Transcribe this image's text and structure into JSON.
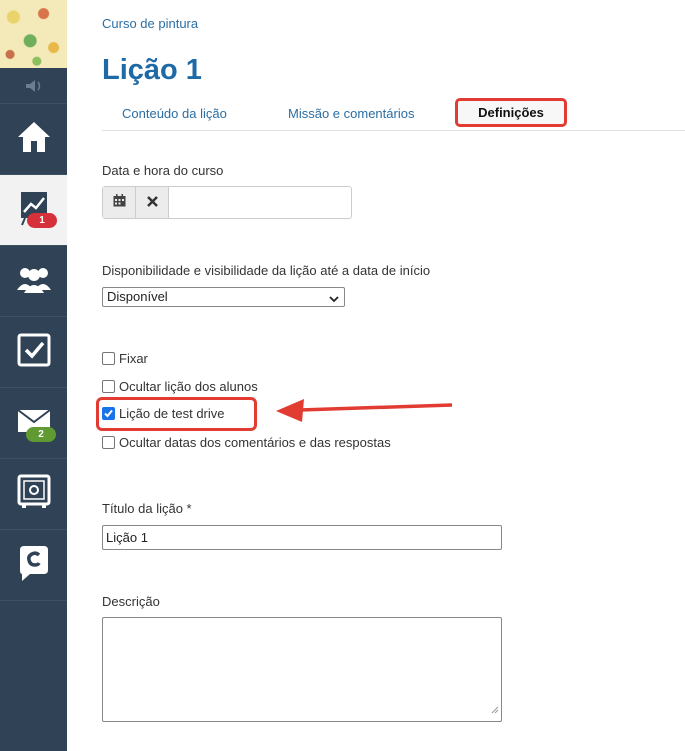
{
  "breadcrumb": "Curso de pintura",
  "page_title": "Lição 1",
  "tabs": [
    {
      "label": "Conteúdo da lição"
    },
    {
      "label": "Missão e comentários"
    },
    {
      "label": "Definições"
    }
  ],
  "sidebar": {
    "items": [
      {
        "icon": "home-icon"
      },
      {
        "icon": "chart-icon",
        "badge": "1"
      },
      {
        "icon": "group-icon"
      },
      {
        "icon": "checkbox-icon"
      },
      {
        "icon": "mail-icon",
        "badge": "2"
      },
      {
        "icon": "safe-icon"
      },
      {
        "icon": "chat-c-icon"
      }
    ]
  },
  "form": {
    "date_label": "Data e hora do curso",
    "date_value": "",
    "availability_label": "Disponibilidade e visibilidade da lição até a data de início",
    "availability_value": "Disponível",
    "options": [
      {
        "label": "Fixar",
        "checked": false
      },
      {
        "label": "Ocultar lição dos alunos",
        "checked": false
      },
      {
        "label": "Lição de test drive",
        "checked": true
      },
      {
        "label": "Ocultar datas dos comentários e das respostas",
        "checked": false
      }
    ],
    "title_label": "Título da lição *",
    "title_value": "Lição 1",
    "description_label": "Descrição",
    "description_value": ""
  },
  "colors": {
    "sidebar": "#2f4256",
    "accent": "#1e6aa6",
    "highlight": "#e23b32",
    "badge_red": "#d6303a",
    "badge_green": "#5f9a32"
  }
}
